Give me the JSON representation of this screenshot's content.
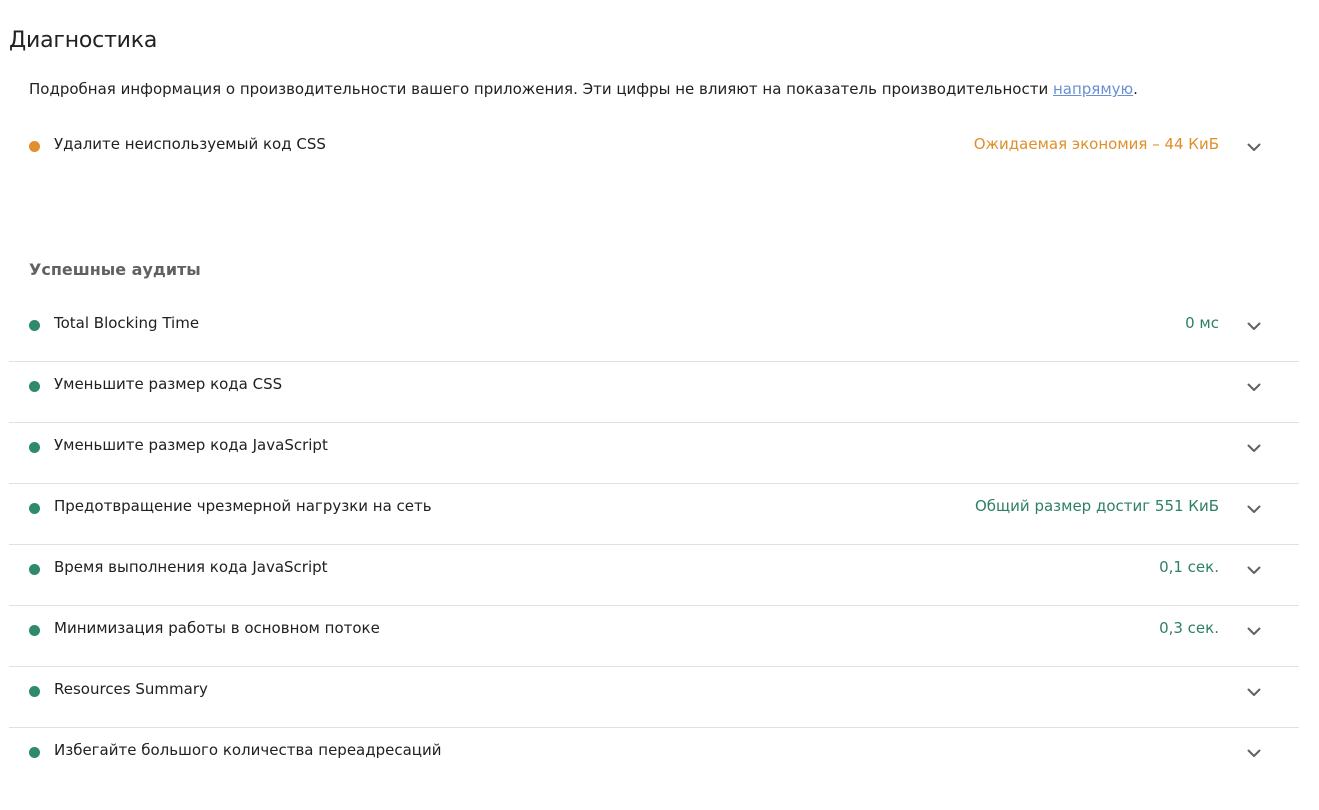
{
  "section": {
    "title": "Диагностика",
    "description_text": "Подробная информация о производительности вашего приложения. Эти цифры не влияют на показатель производительности ",
    "description_link": "напрямую",
    "description_end": "."
  },
  "colors": {
    "average": "#e08f2a",
    "pass": "#2e8065",
    "pass_dot": "#2f8a6a"
  },
  "diagnostics": [
    {
      "title": "Удалите неиспользуемый код CSS",
      "value": "Ожидаемая экономия – 44 КиБ",
      "status": "average"
    }
  ],
  "passed_group": {
    "title": "Успешные аудиты",
    "items": [
      {
        "title": "Total Blocking Time",
        "value": "0 мс",
        "status": "pass"
      },
      {
        "title": "Уменьшите размер кода CSS",
        "value": "",
        "status": "pass"
      },
      {
        "title": "Уменьшите размер кода JavaScript",
        "value": "",
        "status": "pass"
      },
      {
        "title": "Предотвращение чрезмерной нагрузки на сеть",
        "value": "Общий размер достиг 551 КиБ",
        "status": "pass"
      },
      {
        "title": "Время выполнения кода JavaScript",
        "value": "0,1 сек.",
        "status": "pass"
      },
      {
        "title": "Минимизация работы в основном потоке",
        "value": "0,3 сек.",
        "status": "pass"
      },
      {
        "title": "Resources Summary",
        "value": "",
        "status": "pass"
      },
      {
        "title": "Избегайте большого количества переадресаций",
        "value": "",
        "status": "pass"
      }
    ]
  },
  "icons": {
    "expand": "chevron-down-icon",
    "status": "status-dot-icon"
  }
}
